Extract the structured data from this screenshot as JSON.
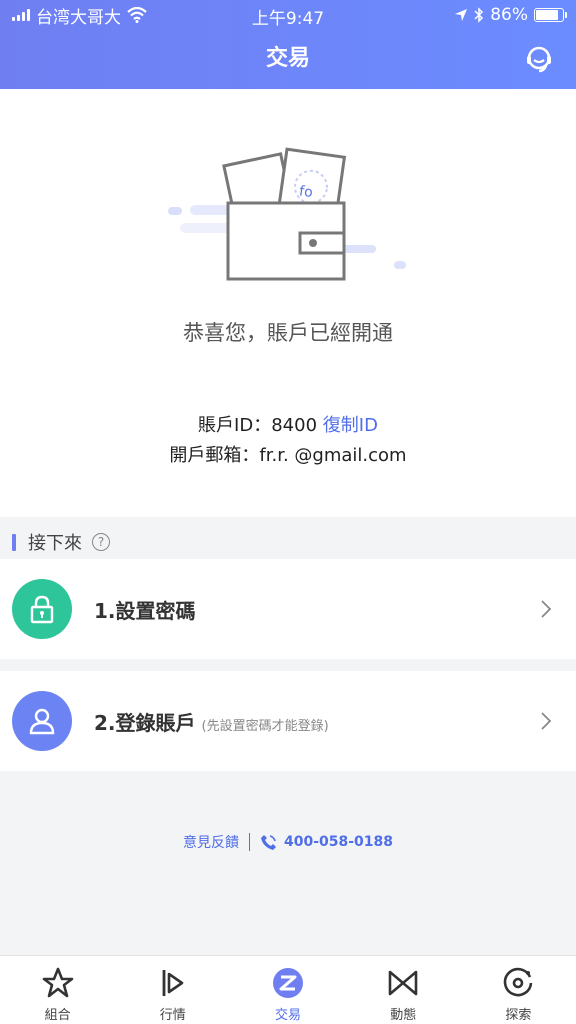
{
  "status_bar": {
    "carrier": "台湾大哥大",
    "time": "上午9:47",
    "battery": "86%",
    "battery_level": 0.86
  },
  "header": {
    "title": "交易",
    "support_icon": "headset-icon"
  },
  "success": {
    "illustration": "wallet-illustration",
    "message": "恭喜您，賬戶已經開通",
    "account_label": "賬戶ID：",
    "account_id": "8400",
    "copy_label": "復制ID",
    "email_label": "開戶郵箱：",
    "email": "fr.r.    @gmail.com"
  },
  "next_section": {
    "label": "接下來",
    "help_icon": "question-icon"
  },
  "steps": [
    {
      "title": "1.設置密碼",
      "subtitle": "",
      "icon": "lock-icon",
      "color": "#2fc59a"
    },
    {
      "title": "2.登錄賬戶",
      "subtitle": "(先設置密碼才能登錄)",
      "icon": "user-icon",
      "color": "#6b83f3"
    }
  ],
  "footer": {
    "feedback": "意見反饋",
    "phone": "400-058-0188"
  },
  "tabbar": [
    {
      "label": "組合",
      "icon": "star-icon",
      "active": false
    },
    {
      "label": "行情",
      "icon": "flag-play-icon",
      "active": false
    },
    {
      "label": "交易",
      "icon": "trade-icon",
      "active": true
    },
    {
      "label": "動態",
      "icon": "bowtie-icon",
      "active": false
    },
    {
      "label": "探索",
      "icon": "discover-icon",
      "active": false
    }
  ],
  "colors": {
    "accent": "#6f7ff2",
    "link": "#4f6ee8",
    "green": "#2fc59a"
  }
}
